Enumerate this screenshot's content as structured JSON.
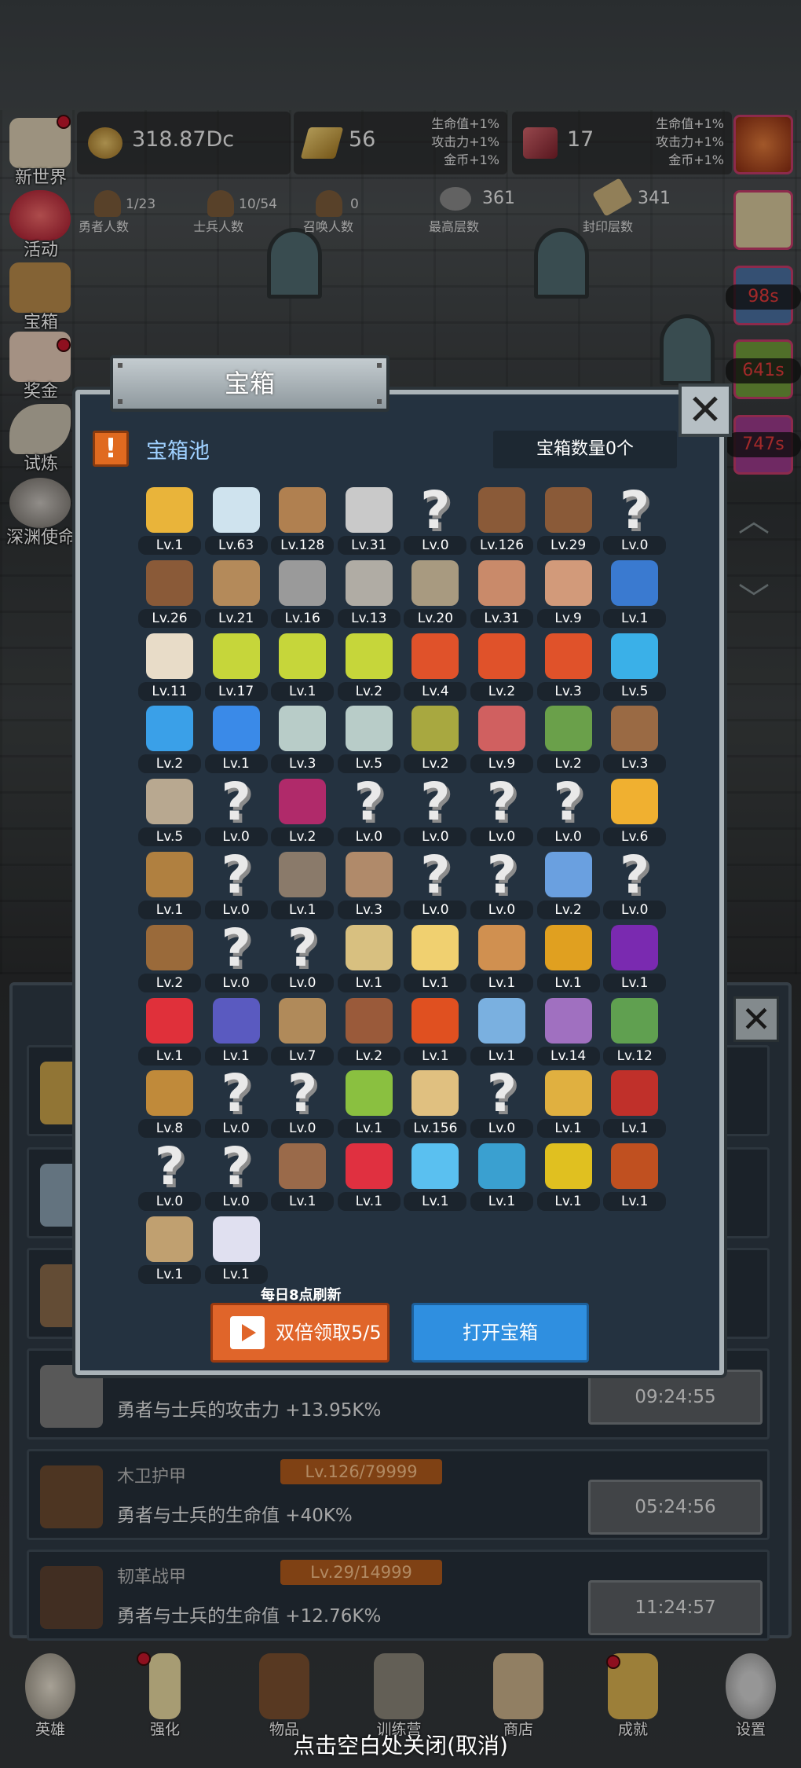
{
  "resources": {
    "gold": "318.87Dc",
    "bar": "56",
    "gem": "17"
  },
  "bonus_left": [
    "生命值+1%",
    "攻击力+1%",
    "金币+1%"
  ],
  "bonus_right": [
    "生命值+1%",
    "攻击力+1%",
    "金币+1%"
  ],
  "stats": [
    {
      "value": "1/23",
      "label": "勇者人数"
    },
    {
      "value": "10/54",
      "label": "士兵人数"
    },
    {
      "value": "0",
      "label": "召唤人数"
    },
    {
      "value": "361",
      "label": "最高层数"
    },
    {
      "value": "341",
      "label": "封印层数"
    }
  ],
  "side_menu": [
    "新世界",
    "活动",
    "宝箱",
    "奖金",
    "试炼",
    "深渊使命"
  ],
  "timers": [
    "98s",
    "641s",
    "747s"
  ],
  "modal": {
    "title": "宝箱",
    "pool_label": "宝箱池",
    "count_label": "宝箱数量0个",
    "refresh_note": "每日8点刷新",
    "double_btn": "双倍领取5/5",
    "open_btn": "打开宝箱",
    "close": "✕"
  },
  "items": [
    {
      "icon": "crown",
      "lv": "Lv.1"
    },
    {
      "icon": "diamond",
      "lv": "Lv.63"
    },
    {
      "icon": "wood-sword",
      "lv": "Lv.128"
    },
    {
      "icon": "iron-sword",
      "lv": "Lv.31"
    },
    {
      "icon": "unknown",
      "lv": "Lv.0"
    },
    {
      "icon": "leather-armor",
      "lv": "Lv.126"
    },
    {
      "icon": "backpack-armor",
      "lv": "Lv.29"
    },
    {
      "icon": "unknown",
      "lv": "Lv.0"
    },
    {
      "icon": "helmet",
      "lv": "Lv.26"
    },
    {
      "icon": "dagger",
      "lv": "Lv.21"
    },
    {
      "icon": "knight-helm",
      "lv": "Lv.16"
    },
    {
      "icon": "hammer",
      "lv": "Lv.13"
    },
    {
      "icon": "great-helm",
      "lv": "Lv.20"
    },
    {
      "icon": "ham",
      "lv": "Lv.31"
    },
    {
      "icon": "steak",
      "lv": "Lv.9"
    },
    {
      "icon": "bag",
      "lv": "Lv.1"
    },
    {
      "icon": "flour",
      "lv": "Lv.11"
    },
    {
      "icon": "yellow-potion",
      "lv": "Lv.17"
    },
    {
      "icon": "yellow-flask",
      "lv": "Lv.1"
    },
    {
      "icon": "yellow-potion",
      "lv": "Lv.2"
    },
    {
      "icon": "red-potion",
      "lv": "Lv.4"
    },
    {
      "icon": "red-flask",
      "lv": "Lv.2"
    },
    {
      "icon": "red-potion",
      "lv": "Lv.3"
    },
    {
      "icon": "blue-vial",
      "lv": "Lv.5"
    },
    {
      "icon": "blue-flask",
      "lv": "Lv.2"
    },
    {
      "icon": "blue-potion",
      "lv": "Lv.1"
    },
    {
      "icon": "grey-vial",
      "lv": "Lv.3"
    },
    {
      "icon": "grey-vial",
      "lv": "Lv.5"
    },
    {
      "icon": "olive-bottle",
      "lv": "Lv.2"
    },
    {
      "icon": "red-bottle",
      "lv": "Lv.9"
    },
    {
      "icon": "green-boot",
      "lv": "Lv.2"
    },
    {
      "icon": "brown-boot",
      "lv": "Lv.3"
    },
    {
      "icon": "cloth-boot",
      "lv": "Lv.5"
    },
    {
      "icon": "unknown",
      "lv": "Lv.0"
    },
    {
      "icon": "purple-boot",
      "lv": "Lv.2"
    },
    {
      "icon": "unknown",
      "lv": "Lv.0"
    },
    {
      "icon": "unknown",
      "lv": "Lv.0"
    },
    {
      "icon": "unknown",
      "lv": "Lv.0"
    },
    {
      "icon": "unknown",
      "lv": "Lv.0"
    },
    {
      "icon": "torch",
      "lv": "Lv.6"
    },
    {
      "icon": "wand",
      "lv": "Lv.1"
    },
    {
      "icon": "unknown",
      "lv": "Lv.0"
    },
    {
      "icon": "pickaxe",
      "lv": "Lv.1"
    },
    {
      "icon": "staff",
      "lv": "Lv.3"
    },
    {
      "icon": "unknown",
      "lv": "Lv.0"
    },
    {
      "icon": "unknown",
      "lv": "Lv.0"
    },
    {
      "icon": "blue-wand",
      "lv": "Lv.2"
    },
    {
      "icon": "unknown",
      "lv": "Lv.0"
    },
    {
      "icon": "satchel",
      "lv": "Lv.2"
    },
    {
      "icon": "unknown",
      "lv": "Lv.0"
    },
    {
      "icon": "unknown",
      "lv": "Lv.0"
    },
    {
      "icon": "broom",
      "lv": "Lv.1"
    },
    {
      "icon": "cheese",
      "lv": "Lv.1"
    },
    {
      "icon": "pie",
      "lv": "Lv.1"
    },
    {
      "icon": "honey-jar",
      "lv": "Lv.1"
    },
    {
      "icon": "crystal",
      "lv": "Lv.1"
    },
    {
      "icon": "red-orb",
      "lv": "Lv.1"
    },
    {
      "icon": "gem-orb",
      "lv": "Lv.1"
    },
    {
      "icon": "bow",
      "lv": "Lv.7"
    },
    {
      "icon": "quiver",
      "lv": "Lv.2"
    },
    {
      "icon": "fire-shield",
      "lv": "Lv.1"
    },
    {
      "icon": "blue-rune",
      "lv": "Lv.1"
    },
    {
      "icon": "octopus",
      "lv": "Lv.14"
    },
    {
      "icon": "emblem",
      "lv": "Lv.12"
    },
    {
      "icon": "scroll-staff",
      "lv": "Lv.8"
    },
    {
      "icon": "unknown",
      "lv": "Lv.0"
    },
    {
      "icon": "unknown",
      "lv": "Lv.0"
    },
    {
      "icon": "green-scepter",
      "lv": "Lv.1"
    },
    {
      "icon": "beer-mug",
      "lv": "Lv.156"
    },
    {
      "icon": "unknown",
      "lv": "Lv.0"
    },
    {
      "icon": "gold-pickaxe",
      "lv": "Lv.1"
    },
    {
      "icon": "red-book",
      "lv": "Lv.1"
    },
    {
      "icon": "unknown",
      "lv": "Lv.0"
    },
    {
      "icon": "unknown",
      "lv": "Lv.0"
    },
    {
      "icon": "whip",
      "lv": "Lv.1"
    },
    {
      "icon": "red-card",
      "lv": "Lv.1"
    },
    {
      "icon": "crystal-ball",
      "lv": "Lv.1"
    },
    {
      "icon": "rune-disk",
      "lv": "Lv.1"
    },
    {
      "icon": "gold-orb",
      "lv": "Lv.1"
    },
    {
      "icon": "hammer-red",
      "lv": "Lv.1"
    },
    {
      "icon": "wood-totem",
      "lv": "Lv.1"
    },
    {
      "icon": "rainbow-orb",
      "lv": "Lv.1"
    }
  ],
  "rows": [
    {
      "name": "",
      "lv": "",
      "desc": "勇者与士兵的攻击力 +13.95K%",
      "time": "09:24:55"
    },
    {
      "name": "木卫护甲",
      "lv": "Lv.126/79999",
      "desc": "勇者与士兵的生命值 +40K%",
      "time": "05:24:56"
    },
    {
      "name": "韧革战甲",
      "lv": "Lv.29/14999",
      "desc": "勇者与士兵的生命值 +12.76K%",
      "time": "11:24:57"
    }
  ],
  "nav": [
    "英雄",
    "强化",
    "物品",
    "训练营",
    "商店",
    "成就",
    "设置"
  ],
  "hint": "点击空白处关闭(取消)"
}
